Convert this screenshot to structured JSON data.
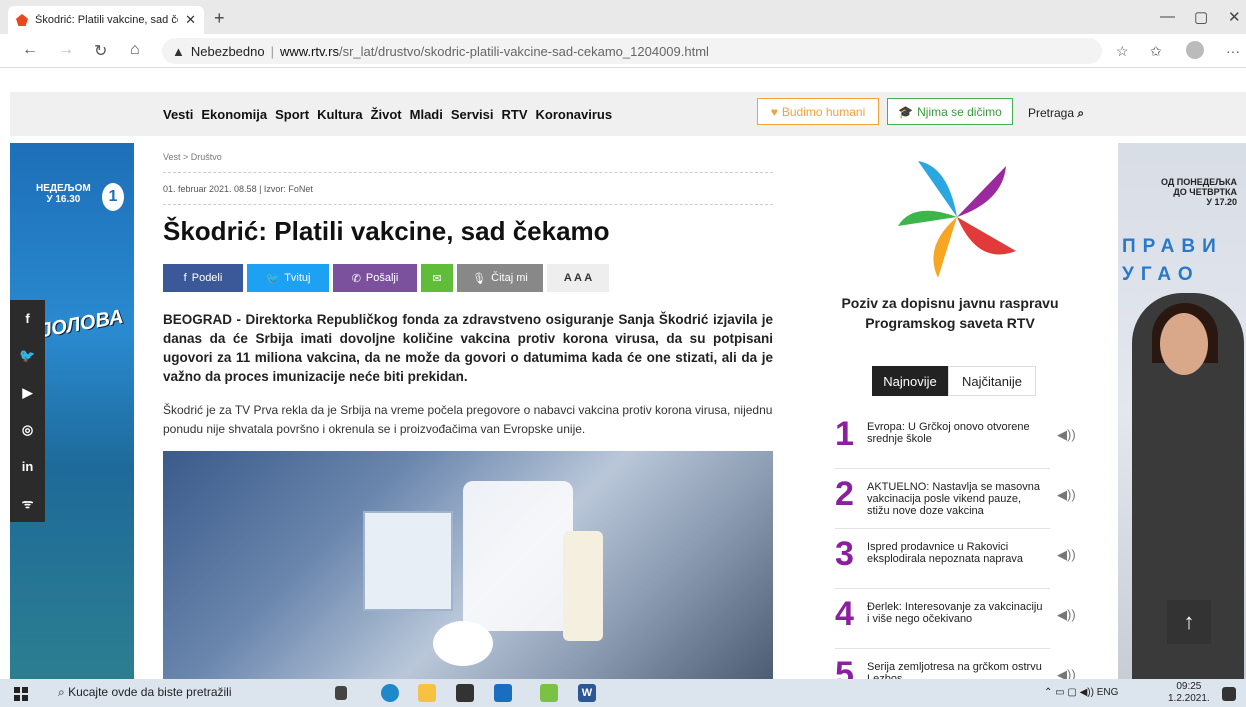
{
  "browser": {
    "tab_title": "Škodrić: Platili vakcine, sad čekamo",
    "tab_title_visible": "Škodrić: Platili vakcine, sad čekar",
    "new_tab": "+",
    "security_label": "Nebezbedno",
    "url_domain": "www.rtv.rs",
    "url_path": "/sr_lat/drustvo/skodric-platili-vakcine-sad-cekamo_1204009.html"
  },
  "nav": {
    "links": [
      "Vesti",
      "Ekonomija",
      "Sport",
      "Kultura",
      "Život",
      "Mladi",
      "Servisi",
      "RTV",
      "Koronavirus"
    ],
    "budimo_humani": "Budimo humani",
    "njima_se_dicimo": "Njima se dičimo",
    "search_label": "Pretraga"
  },
  "left_ad": {
    "text": "НЕДЕЉОМ\nУ 16.30",
    "logo": "1",
    "brand": "ЈОЛОВА"
  },
  "article": {
    "breadcrumb": "Vest > Društvo",
    "date_source": "01. februar 2021. 08.58 | Izvor: FoNet",
    "headline": "Škodrić: Platili vakcine, sad čekamo",
    "share": {
      "podeli": "Podeli",
      "tvituj": "Tvituj",
      "posalji": "Pošalji",
      "citaj_mi": "Čitaj mi",
      "font_sizes": "A A A"
    },
    "lead": "BEOGRAD - Direktorka Republičkog fonda za zdravstveno osiguranje Sanja Škodrić izjavila je danas da će Srbija imati dovoljne količine vakcina protiv korona virusa, da su potpisani ugovori za 11 miliona vakcina, da ne može da govori o datumima kada će one stizati, ali da je važno da proces imunizacije neće biti prekidan.",
    "body": "Škodrić je za TV Prva rekla da je Srbija na vreme počela pregovore o nabavci vakcina protiv korona virusa, nijednu ponudu nije shvatala površno i okrenula se i proizvođačima van Evropske unije."
  },
  "sidebar": {
    "poziv": "Poziv za dopisnu javnu raspravu Programskog saveta RTV",
    "tab_newest": "Najnovije",
    "tab_most_read": "Najčitanije",
    "items": [
      {
        "num": "1",
        "text": "Evropa: U Grčkoj onovo otvorene srednje škole"
      },
      {
        "num": "2",
        "text": "AKTUELNO: Nastavlja se masovna vakcinacija posle vikend pauze, stižu nove doze vakcina"
      },
      {
        "num": "3",
        "text": "Ispred prodavnice u Rakovici eksplodirala nepoznata naprava"
      },
      {
        "num": "4",
        "text": "Đerlek: Interesovanje za vakcinaciju i više nego očekivano"
      },
      {
        "num": "5",
        "text": "Serija zemljotresa na grčkom ostrvu Lezbos"
      }
    ]
  },
  "right_ad": {
    "text": "ОД ПОНЕДЕЉКА\nДО ЧЕТВРТКА\nУ 17.20",
    "brand": "ПРАВИ\nУГАО"
  },
  "taskbar": {
    "search_placeholder": "Kucajte ovde da biste pretražili",
    "lang": "ENG",
    "time": "09:25",
    "date": "1.2.2021."
  },
  "colors": {
    "accent_purple": "#8b1fa0",
    "facebook": "#3b5998",
    "twitter": "#1da1f2",
    "viber": "#7b519d",
    "email": "#5fbd3a",
    "gray_button": "#888888"
  }
}
